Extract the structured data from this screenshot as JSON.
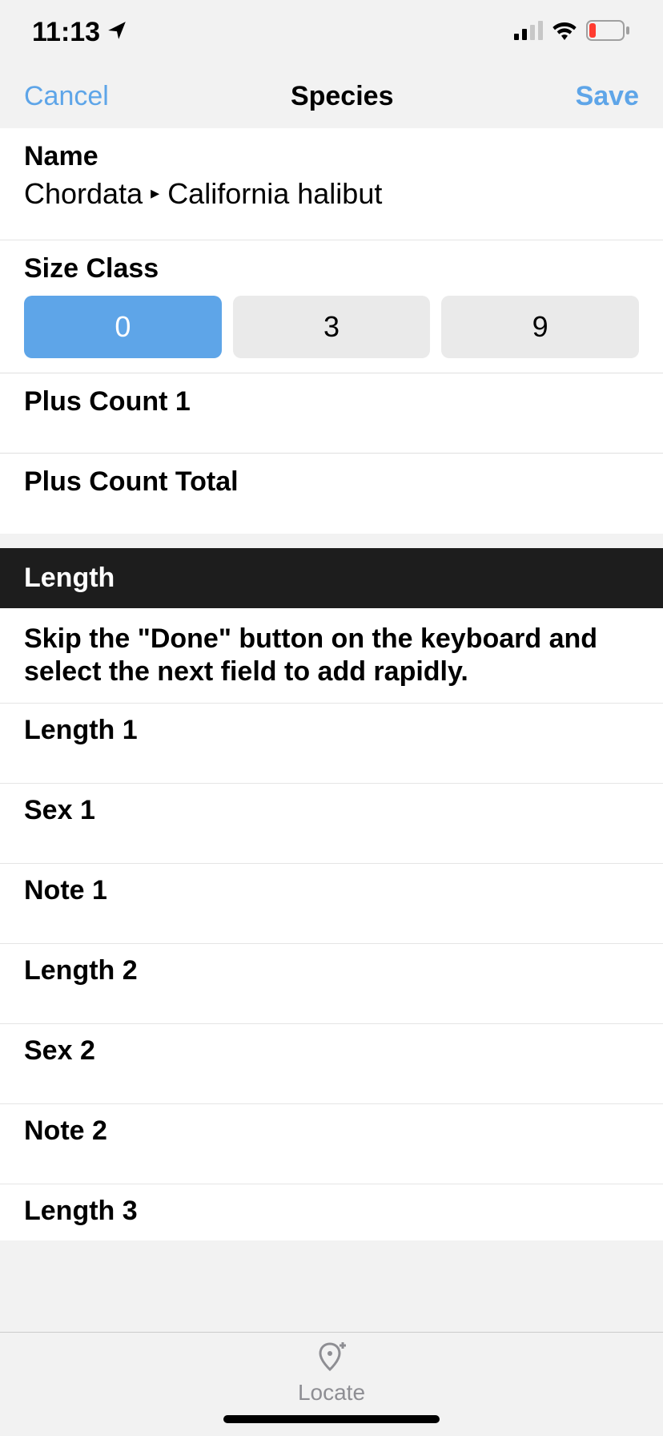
{
  "status": {
    "time": "11:13"
  },
  "nav": {
    "cancel": "Cancel",
    "title": "Species",
    "save": "Save"
  },
  "fields": {
    "name": {
      "label": "Name",
      "value_prefix": "Chordata",
      "value_suffix": "California halibut"
    },
    "size_class": {
      "label": "Size Class",
      "options": [
        "0",
        "3",
        "9"
      ],
      "selected": 0
    },
    "plus_count_1": {
      "label": "Plus Count 1"
    },
    "plus_count_total": {
      "label": "Plus Count Total"
    }
  },
  "length_section": {
    "header": "Length",
    "hint": "Skip the \"Done\" button on the keyboard and select the next field to add rapidly.",
    "rows": [
      {
        "label": "Length 1"
      },
      {
        "label": "Sex 1"
      },
      {
        "label": "Note 1"
      },
      {
        "label": "Length 2"
      },
      {
        "label": "Sex 2"
      },
      {
        "label": "Note 2"
      },
      {
        "label": "Length 3"
      }
    ]
  },
  "toolbar": {
    "locate": "Locate"
  }
}
